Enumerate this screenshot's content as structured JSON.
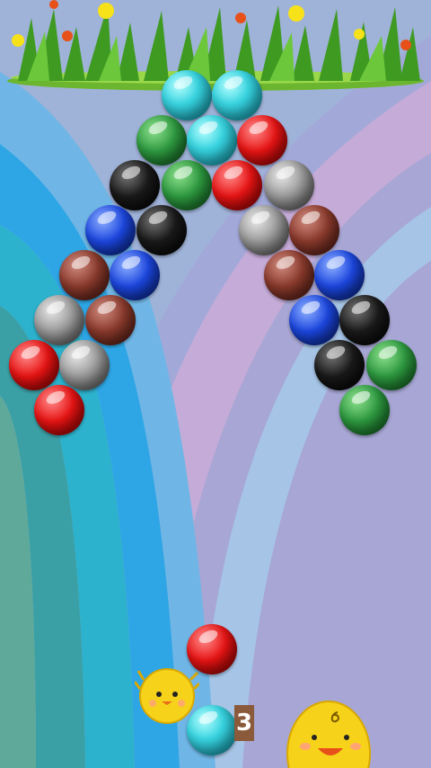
{
  "colors": {
    "cyan": "#38d4e0",
    "green": "#2e9a40",
    "red": "#e81414",
    "black": "#1a1a1a",
    "gray": "#9a9a9a",
    "blue": "#1c47e0",
    "brown": "#8a3a2c"
  },
  "board": {
    "bubbles": [
      "cyan",
      "cyan",
      "green",
      "cyan",
      "red",
      "black",
      "green",
      "red",
      "gray",
      "blue",
      "black",
      "gray",
      "brown",
      "brown",
      "blue",
      "brown",
      "blue",
      "gray",
      "brown",
      "blue",
      "black",
      "red",
      "gray",
      "black",
      "green",
      "red",
      "green"
    ]
  },
  "shooter": {
    "loaded_color": "red",
    "next_color": "cyan",
    "remaining_count": "3"
  },
  "icons": [
    "grass-flowers-icon",
    "chick-launcher-icon",
    "smiling-chick-icon"
  ]
}
